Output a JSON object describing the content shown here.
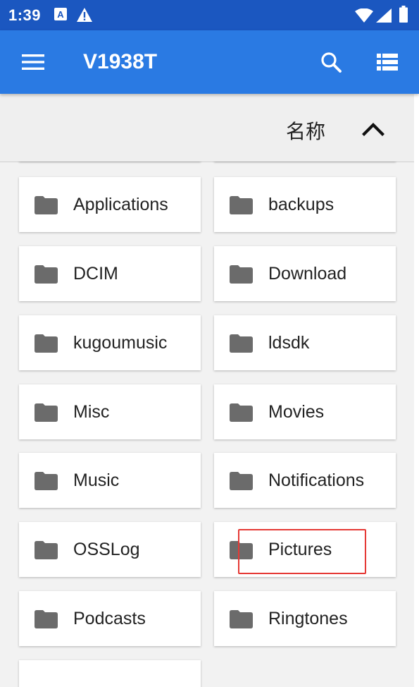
{
  "status_bar": {
    "time": "1:39",
    "icons": [
      "a-notification-icon",
      "warning-icon",
      "wifi-icon",
      "signal-icon",
      "battery-icon"
    ]
  },
  "app_bar": {
    "title": "V1938T",
    "icons": [
      "menu-icon",
      "search-icon",
      "list-view-icon"
    ]
  },
  "sort_bar": {
    "label": "名称",
    "direction_icon": "chevron-up-icon"
  },
  "folders": [
    {
      "name": "Applications"
    },
    {
      "name": "backups"
    },
    {
      "name": "DCIM"
    },
    {
      "name": "Download"
    },
    {
      "name": "kugoumusic"
    },
    {
      "name": "ldsdk"
    },
    {
      "name": "Misc"
    },
    {
      "name": "Movies"
    },
    {
      "name": "Music"
    },
    {
      "name": "Notifications"
    },
    {
      "name": "OSSLog"
    },
    {
      "name": "Pictures"
    },
    {
      "name": "Podcasts"
    },
    {
      "name": "Ringtones"
    },
    {
      "name": ""
    }
  ],
  "colors": {
    "status_bar": "#1b57c0",
    "app_bar": "#2a7ae3",
    "folder_icon": "#6b6b6b",
    "highlight": "#e53935"
  }
}
